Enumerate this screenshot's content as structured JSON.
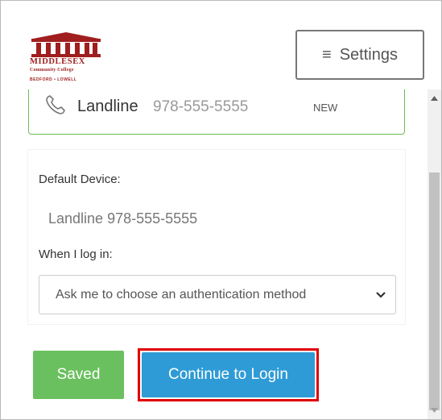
{
  "header": {
    "logo": {
      "line1": "MIDDLESEX",
      "line2": "Community College",
      "line3": "BEDFORD • LOWELL"
    },
    "settings_label": "Settings",
    "menu_icon": "≡"
  },
  "device_card": {
    "icon": "phone-icon",
    "type": "Landline",
    "number": "978-555-5555",
    "badge": "NEW",
    "border_color": "#6dbb53"
  },
  "preferences": {
    "default_device_label": "Default Device:",
    "default_device_value": "Landline 978-555-5555",
    "when_login_label": "When I log in:",
    "login_option_selected": "Ask me to choose an authentication method"
  },
  "actions": {
    "saved_label": "Saved",
    "continue_label": "Continue to Login"
  },
  "colors": {
    "saved_green": "#6ac05e",
    "continue_blue": "#2e9bd6",
    "highlight_red": "#e00000",
    "brand_red": "#a01e1e"
  }
}
